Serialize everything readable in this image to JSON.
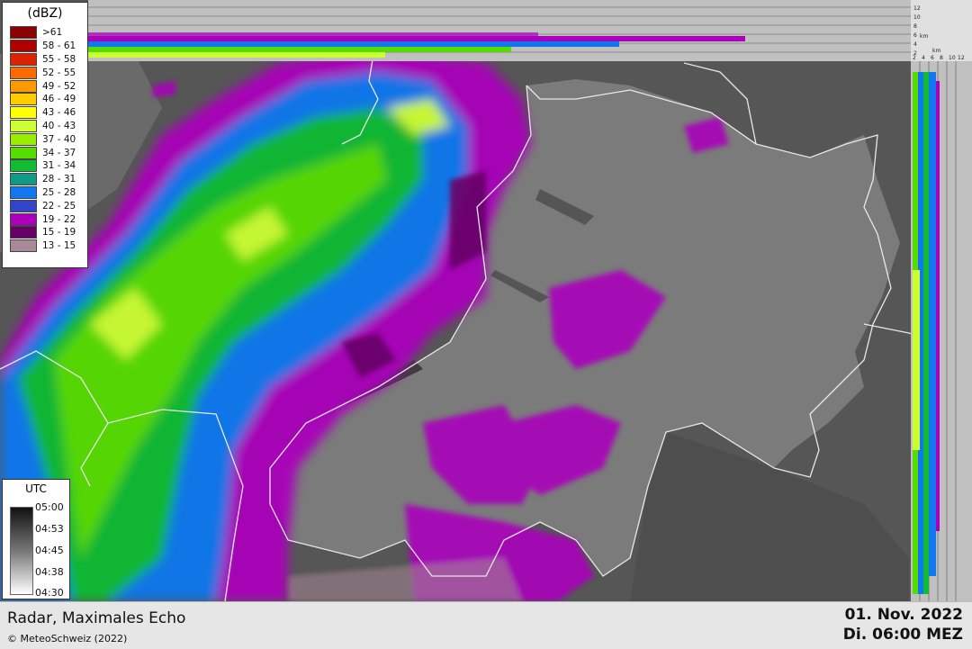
{
  "legend": {
    "title": "(dBZ)",
    "items": [
      {
        "label": ">61",
        "color": "#8b0000"
      },
      {
        "label": "58 - 61",
        "color": "#b00000"
      },
      {
        "label": "55 - 58",
        "color": "#dd2200"
      },
      {
        "label": "52 - 55",
        "color": "#ff6a00"
      },
      {
        "label": "49 - 52",
        "color": "#ff9900"
      },
      {
        "label": "46 - 49",
        "color": "#ffcc00"
      },
      {
        "label": "43 - 46",
        "color": "#ffff00"
      },
      {
        "label": "40 - 43",
        "color": "#ccff33"
      },
      {
        "label": "37 - 40",
        "color": "#99ee00"
      },
      {
        "label": "34 - 37",
        "color": "#55dd00"
      },
      {
        "label": "31 - 34",
        "color": "#11bb33"
      },
      {
        "label": "28 - 31",
        "color": "#119988"
      },
      {
        "label": "25 - 28",
        "color": "#1177ee"
      },
      {
        "label": "22 - 25",
        "color": "#3344cc"
      },
      {
        "label": "19 - 22",
        "color": "#aa00bb"
      },
      {
        "label": "15 - 19",
        "color": "#660066"
      },
      {
        "label": "13 - 15",
        "color": "#aa8899"
      }
    ]
  },
  "utc": {
    "title": "UTC",
    "ticks": [
      "05:00",
      "04:53",
      "04:45",
      "04:38",
      "04:30"
    ]
  },
  "profile": {
    "top_ticks": [
      "12",
      "10",
      "8",
      "6",
      "4",
      "2"
    ],
    "top_unit": "km",
    "side_unit": "km",
    "side_ticks": [
      "2",
      "4",
      "6",
      "8",
      "10",
      "12"
    ]
  },
  "footer": {
    "product": "Radar, Maximales Echo",
    "copyright": "© MeteoSchweiz (2022)",
    "date": "01. Nov. 2022",
    "time": "Di. 06:00 MEZ"
  }
}
